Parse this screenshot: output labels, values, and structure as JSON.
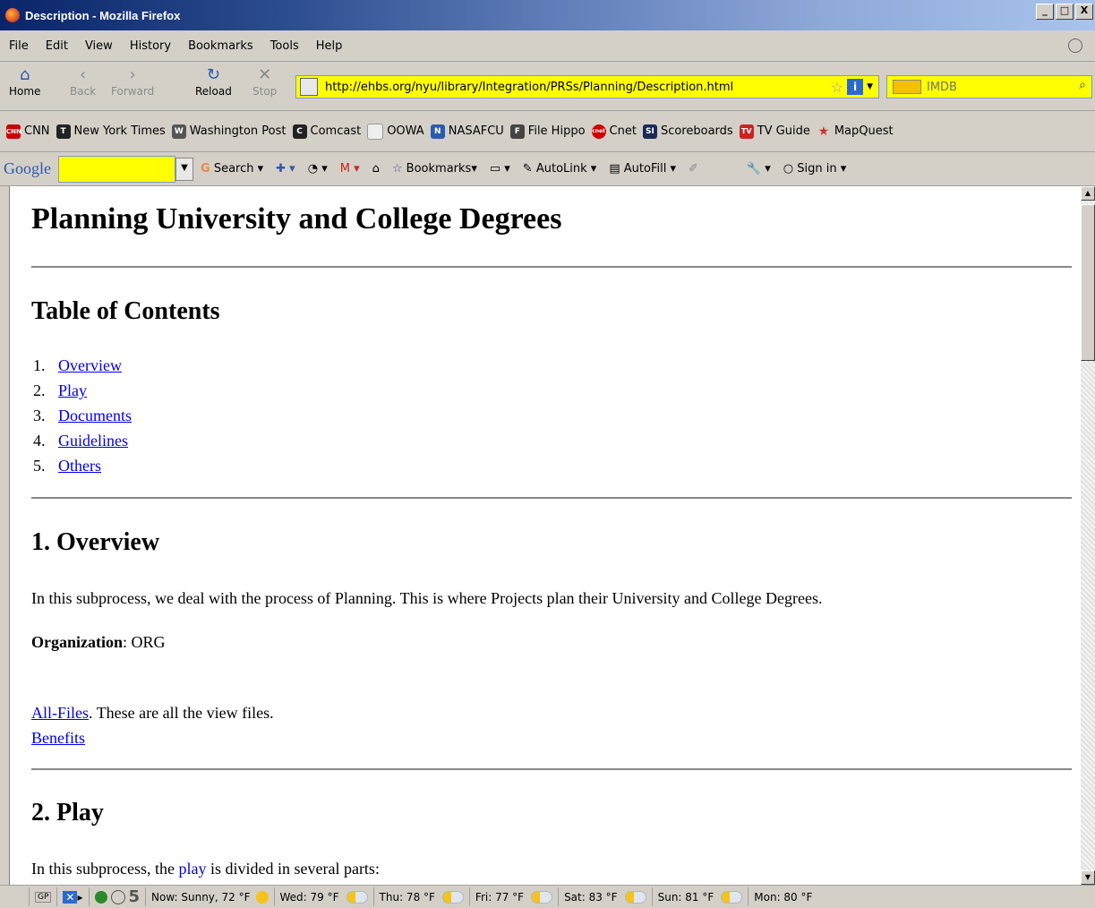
{
  "window": {
    "title": "Description - Mozilla Firefox",
    "buttons": [
      "_",
      "□",
      "X"
    ]
  },
  "menu": [
    "File",
    "Edit",
    "View",
    "History",
    "Bookmarks",
    "Tools",
    "Help"
  ],
  "nav": {
    "home": "Home",
    "back": "Back",
    "forward": "Forward",
    "reload": "Reload",
    "stop": "Stop",
    "url": "http://ehbs.org/nyu/library/Integration/PRSs/Planning/Description.html",
    "search_placeholder": "IMDB"
  },
  "bookmarks": [
    {
      "label": "CNN",
      "icon": "CNN",
      "color": "#cc0000"
    },
    {
      "label": "New York Times",
      "icon": "T",
      "color": "#222222"
    },
    {
      "label": "Washington Post",
      "icon": "W",
      "color": "#555555"
    },
    {
      "label": "Comcast",
      "icon": "C",
      "color": "#222222"
    },
    {
      "label": "OOWA",
      "icon": "",
      "color": "#eeeeee"
    },
    {
      "label": "NASAFCU",
      "icon": "N",
      "color": "#2a5bb0"
    },
    {
      "label": "File Hippo",
      "icon": "F",
      "color": "#444444"
    },
    {
      "label": "Cnet",
      "icon": "cnet",
      "color": "#cc0000"
    },
    {
      "label": "Scoreboards",
      "icon": "SI",
      "color": "#1a2a55"
    },
    {
      "label": "TV Guide",
      "icon": "TV",
      "color": "#cc2222"
    },
    {
      "label": "MapQuest",
      "icon": "★",
      "color": "#d23030"
    }
  ],
  "google_toolbar": {
    "logo": "Google",
    "search": "Search",
    "bookmarks": "Bookmarks",
    "autolink": "AutoLink",
    "autofill": "AutoFill",
    "signin": "Sign in"
  },
  "page": {
    "title": "Planning University and College Degrees",
    "toc_heading": "Table of Contents",
    "toc": [
      {
        "num": "1.",
        "label": "Overview"
      },
      {
        "num": "2.",
        "label": "Play"
      },
      {
        "num": "3.",
        "label": "Documents"
      },
      {
        "num": "4.",
        "label": "Guidelines"
      },
      {
        "num": "5.",
        "label": "Others"
      }
    ],
    "overview_heading": "1. Overview",
    "overview_text": "In this subprocess, we deal with the process of Planning. This is where Projects plan their University and College Degrees.",
    "org_label": "Organization",
    "org_value": ": ORG",
    "allfiles_link": "All-Files",
    "allfiles_text": ". These are all the view files.",
    "benefits_link": "Benefits",
    "play_heading": "2. Play",
    "play_text_before": "In this subprocess, the ",
    "play_link": "play",
    "play_text_after": " is divided in several parts:"
  },
  "status": {
    "gp": "GP",
    "five": "5",
    "weather": [
      {
        "label": "Now: Sunny, 72 °F",
        "icon": "sun-icon"
      },
      {
        "label": "Wed: 79 °F",
        "icon": "partly-cloudy-icon"
      },
      {
        "label": "Thu: 78 °F",
        "icon": "partly-cloudy-icon"
      },
      {
        "label": "Fri: 77 °F",
        "icon": "partly-cloudy-icon"
      },
      {
        "label": "Sat: 83 °F",
        "icon": "partly-cloudy-icon"
      },
      {
        "label": "Sun: 81 °F",
        "icon": "partly-cloudy-icon"
      },
      {
        "label": "Mon: 80 °F",
        "icon": "partly-cloudy-icon"
      }
    ]
  }
}
